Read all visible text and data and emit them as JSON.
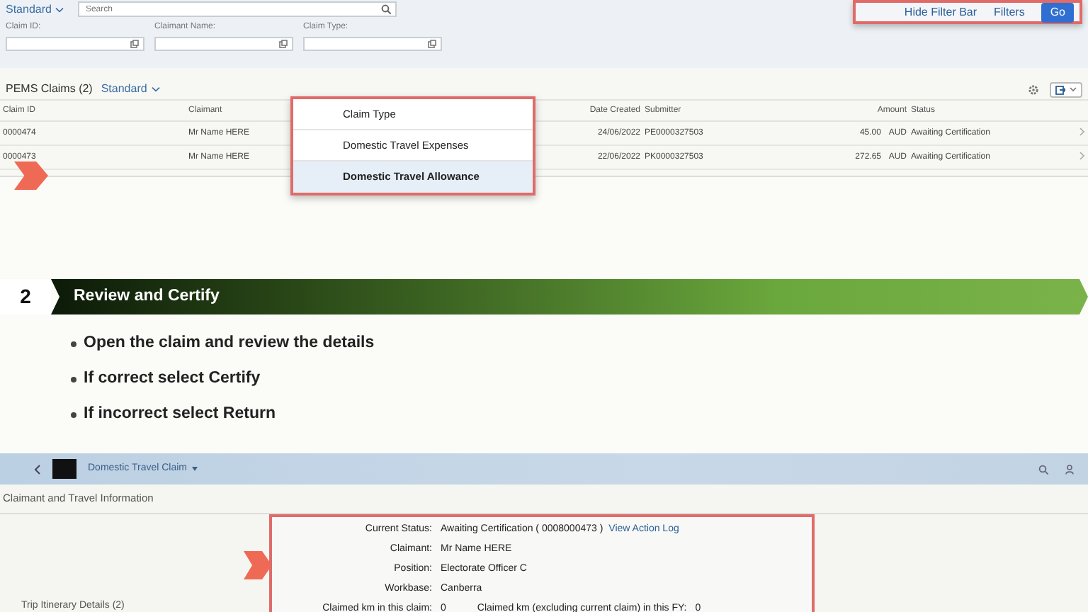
{
  "filter_bar": {
    "variant": "Standard",
    "search": {
      "placeholder": "Search"
    },
    "fields": [
      {
        "label": "Claim ID:"
      },
      {
        "label": "Claimant Name:"
      },
      {
        "label": "Claim Type:"
      }
    ],
    "actions": [
      {
        "label": "Hide Filter Bar",
        "kind": "link"
      },
      {
        "label": "Filters",
        "kind": "link"
      },
      {
        "label": "Go",
        "kind": "primary"
      }
    ]
  },
  "table": {
    "title": "PEMS Claims (2)",
    "variant": "Standard",
    "columns": [
      {
        "label": "Claim ID"
      },
      {
        "label": "Claimant"
      },
      {
        "label": "Date Created"
      },
      {
        "label": "Submitter"
      },
      {
        "label": "Amount"
      },
      {
        "label": "Status"
      }
    ],
    "rows": [
      {
        "cells": [
          "0000474",
          "Mr Name HERE",
          "24/06/2022",
          "PE0000327503",
          "45.00 AUD",
          "Awaiting Certification"
        ]
      },
      {
        "cells": [
          "0000473",
          "Mr Name HERE",
          "22/06/2022",
          "PK0000327503",
          "272.65 AUD",
          "Awaiting Certification"
        ]
      }
    ]
  },
  "claim_type_menu": {
    "header": "Claim Type",
    "items": [
      {
        "label": "Domestic Travel Expenses",
        "selected": false
      },
      {
        "label": "Domestic Travel Allowance",
        "selected": true
      }
    ]
  },
  "step": {
    "number": "2",
    "title": "Review and Certify",
    "bullets": [
      "Open the claim and review the details",
      "If correct select Certify",
      "If incorrect select Return"
    ]
  },
  "claim_app": {
    "title": "Domestic Travel Claim",
    "section": "Claimant and Travel Information",
    "trip_label": "Trip Itinerary Details (2)",
    "details": [
      {
        "label": "Current Status:",
        "value": "Awaiting Certification ( 0008000473 )",
        "link": "View Action Log"
      },
      {
        "label": "Claimant:",
        "value": "Mr Name HERE"
      },
      {
        "label": "Position:",
        "value": "Electorate Officer C"
      },
      {
        "label": "Workbase:",
        "value": "Canberra"
      },
      {
        "label": "Claimed km in this claim:",
        "value": "0",
        "extra_label": "Claimed km (excluding current claim) in this FY:",
        "extra_value": "0"
      }
    ]
  }
}
